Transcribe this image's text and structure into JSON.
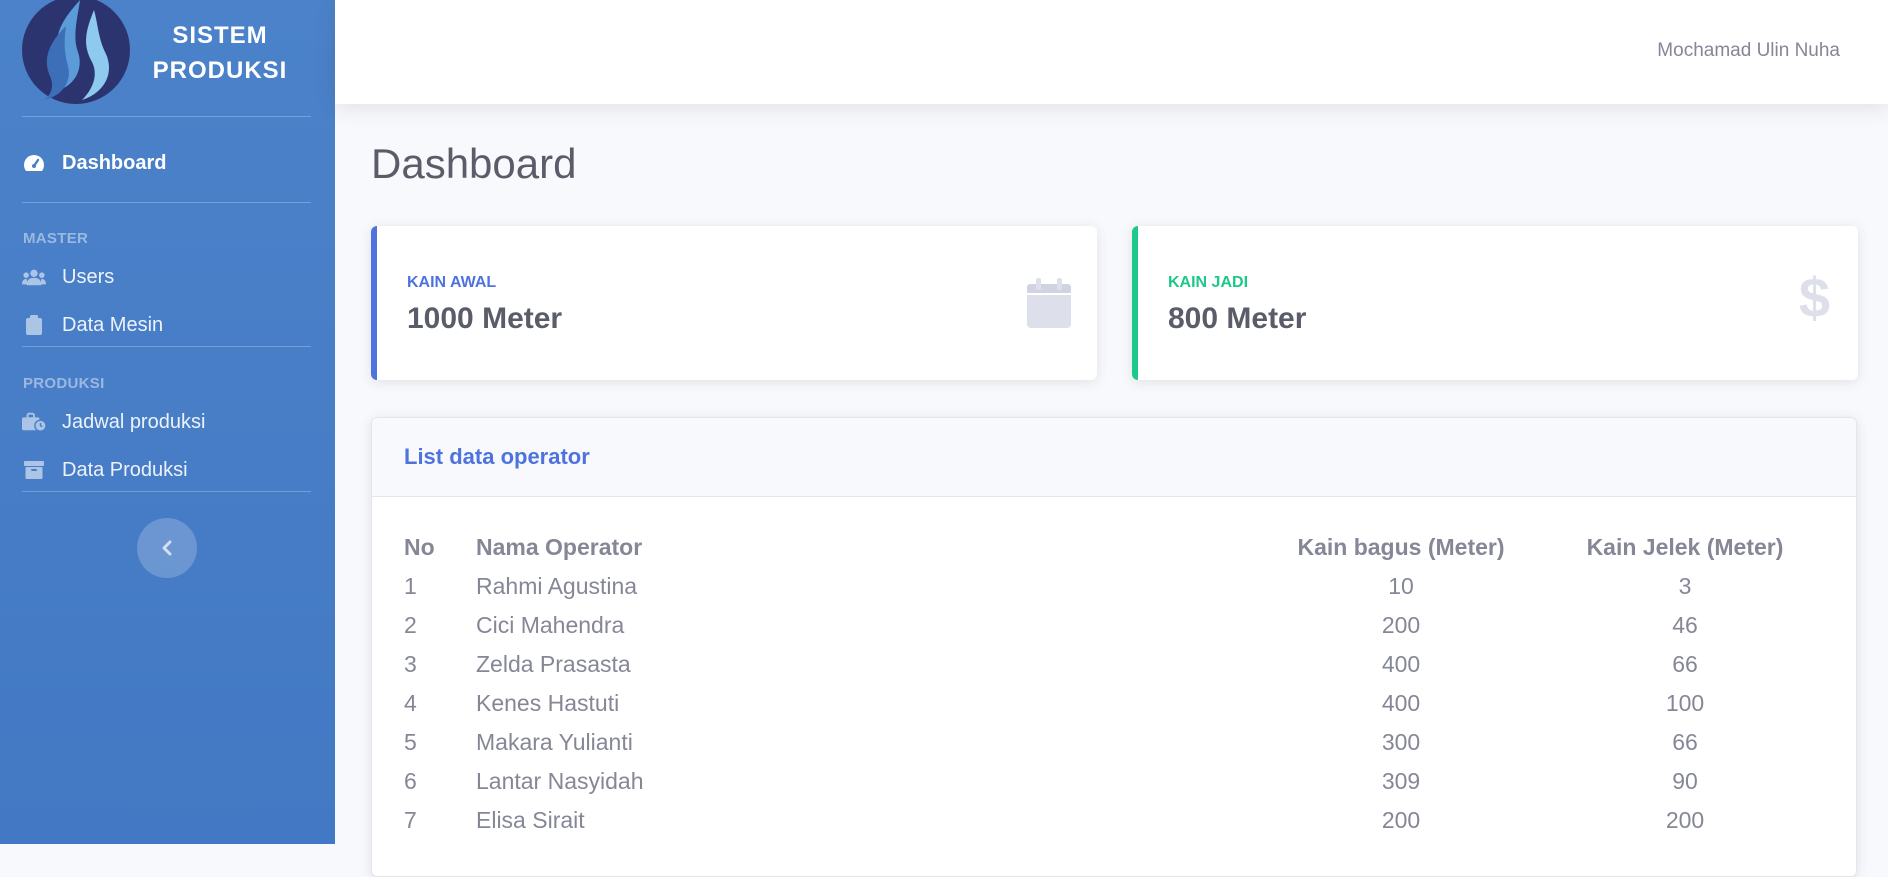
{
  "sidebar": {
    "brand_line1": "SISTEM",
    "brand_line2": "PRODUKSI",
    "dashboard_label": "Dashboard",
    "heading_master": "MASTER",
    "users_label": "Users",
    "data_mesin_label": "Data Mesin",
    "heading_produksi": "PRODUKSI",
    "jadwal_label": "Jadwal produksi",
    "data_produksi_label": "Data Produksi",
    "accent_color": "#4a80c8"
  },
  "topbar": {
    "user_name": "Mochamad Ulin Nuha"
  },
  "page": {
    "title": "Dashboard"
  },
  "cards": [
    {
      "label": "KAIN AWAL",
      "value": "1000 Meter",
      "icon": "calendar-icon",
      "color": "#4e73df"
    },
    {
      "label": "KAIN JADI",
      "value": "800 Meter",
      "icon": "dollar-icon",
      "color": "#1cc88a"
    }
  ],
  "table": {
    "title": "List data operator",
    "headers": [
      "No",
      "Nama Operator",
      "Kain bagus (Meter)",
      "Kain Jelek (Meter)"
    ],
    "rows": [
      [
        "1",
        "Rahmi Agustina",
        "10",
        "3"
      ],
      [
        "2",
        "Cici Mahendra",
        "200",
        "46"
      ],
      [
        "3",
        "Zelda Prasasta",
        "400",
        "66"
      ],
      [
        "4",
        "Kenes Hastuti",
        "400",
        "100"
      ],
      [
        "5",
        "Makara Yulianti",
        "300",
        "66"
      ],
      [
        "6",
        "Lantar Nasyidah",
        "309",
        "90"
      ],
      [
        "7",
        "Elisa Sirait",
        "200",
        "200"
      ]
    ]
  }
}
